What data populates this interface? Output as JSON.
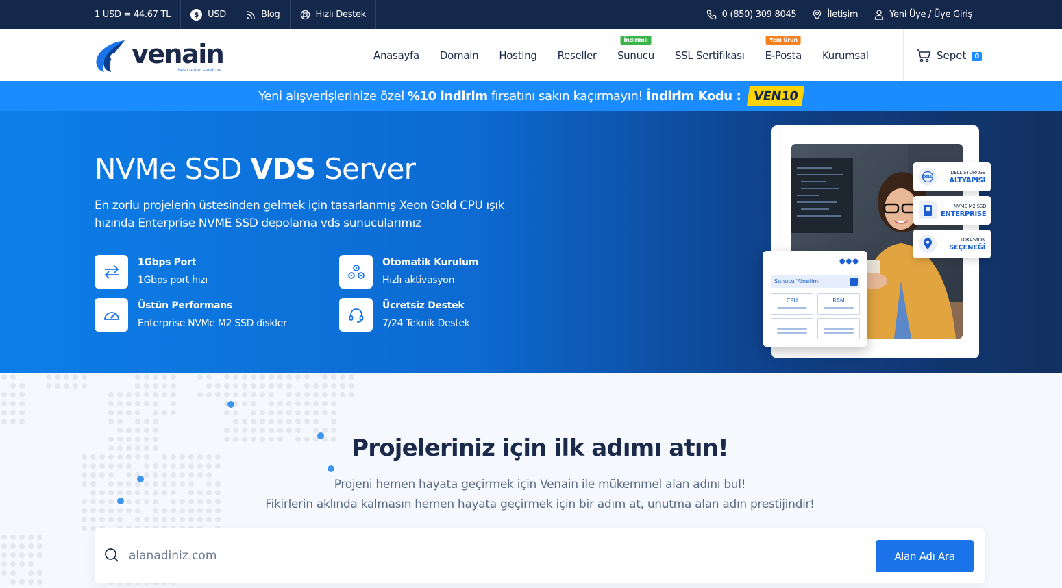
{
  "topbar": {
    "rate": "1 USD = 44.67 TL",
    "currency": "USD",
    "blog": "Blog",
    "support": "Hızlı Destek",
    "phone": "0 (850) 309 8045",
    "contact": "İletişim",
    "account": "Yeni Üye / Üye Giriş"
  },
  "logo": {
    "name": "venain",
    "tagline": "datacenter services"
  },
  "nav": {
    "items": [
      {
        "label": "Anasayfa",
        "badge": "",
        "badge_color": ""
      },
      {
        "label": "Domain",
        "badge": "",
        "badge_color": ""
      },
      {
        "label": "Hosting",
        "badge": "",
        "badge_color": ""
      },
      {
        "label": "Reseller",
        "badge": "",
        "badge_color": ""
      },
      {
        "label": "Sunucu",
        "badge": "İndirimli",
        "badge_color": "#3bb54a"
      },
      {
        "label": "SSL Sertifikası",
        "badge": "",
        "badge_color": ""
      },
      {
        "label": "E-Posta",
        "badge": "Yeni Ürün",
        "badge_color": "#f5821f"
      },
      {
        "label": "Kurumsal",
        "badge": "",
        "badge_color": ""
      }
    ],
    "cart_label": "Sepet",
    "cart_count": "0"
  },
  "promo": {
    "text_a": "Yeni alışverişlerinize özel",
    "text_b": "%10 indirim",
    "text_c": "fırsatını sakın kaçırmayın!",
    "text_d": "İndirim Kodu :",
    "code": "VEN10"
  },
  "hero": {
    "title_a": "NVMe SSD",
    "title_b": "VDS",
    "title_c": "Server",
    "lead": "En zorlu projelerin üstesinden gelmek için tasarlanmış Xeon Gold CPU ışık hızında Enterprise NVME SSD depolama vds sunucularımız",
    "features": [
      {
        "title": "1Gbps Port",
        "desc": "1Gbps port hızı",
        "icon": "transfer-icon"
      },
      {
        "title": "Otomatik Kurulum",
        "desc": "Hızlı aktivasyon",
        "icon": "cogs-icon"
      },
      {
        "title": "Üstün Performans",
        "desc": "Enterprise NVMe M2 SSD diskler",
        "icon": "speedometer-icon"
      },
      {
        "title": "Ücretsiz Destek",
        "desc": "7/24 Teknik Destek",
        "icon": "headset-icon"
      }
    ],
    "tags": [
      {
        "line1": "DELL STORAGE",
        "line2": "ALTYAPISI",
        "icon": "dell-icon"
      },
      {
        "line1": "NVME M2 SSD",
        "line2": "ENTERPRISE",
        "icon": "ssd-icon"
      },
      {
        "line1": "LOKASYON",
        "line2": "SEÇENEĞİ",
        "icon": "location-pin-icon"
      }
    ],
    "panel": {
      "header": "Sunucu Yönetimi",
      "cell1": "CPU",
      "cell2": "RAM"
    }
  },
  "domain": {
    "heading": "Projeleriniz için ilk adımı atın!",
    "line1": "Projeni hemen hayata geçirmek için Venain ile mükemmel alan adını bul!",
    "line2": "Fikirlerin aklında kalmasın hemen hayata geçirmek için bir adım at, unutma alan adın prestijindir!",
    "placeholder": "alanadiniz.com",
    "button": "Alan Adı Ara"
  }
}
